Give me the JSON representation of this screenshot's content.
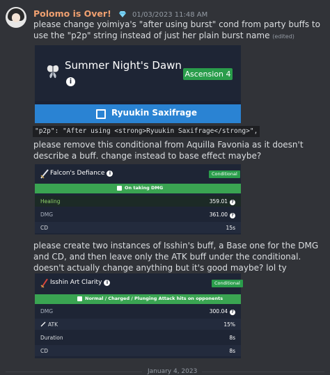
{
  "message": {
    "username": "Polomo is Over!",
    "timestamp": "01/03/2023 11:48 AM",
    "colors": {
      "username": "#f0a070",
      "background": "#313338",
      "text": "#dbdee1"
    },
    "text1": "please change yoimiya's \"after using burst\" cond from party buffs to use the \"p2p\" string instead of just her plain burst name",
    "edited": "(edited)",
    "code": "\"p2p\": \"After using <strong>Ryuukin Saxifrage</strong>\",",
    "text2": "please remove this conditional from Aquilla Favonia as it doesn't describe a buff. change instead to base effect maybe?",
    "text3": "please create two instances of Isshin's buff, a Base one for the DMG and CD, and then leave only the ATK buff under the conditional. doesn't actually change anything but it's good maybe? lol ty"
  },
  "embed1": {
    "title": "Summer Night's Dawn",
    "badge": "Ascension 4",
    "checkbox_label": "Ryuukin Saxifrage",
    "info_glyph": "i",
    "icon": "butterfly-icon"
  },
  "embed2": {
    "title": "Falcon's Defiance",
    "info_glyph": "i",
    "cond_badge": "Conditional",
    "bar_label": "On taking DMG",
    "rows": [
      {
        "label": "Healing",
        "value": "359.01",
        "help": "?"
      },
      {
        "label": "DMG",
        "value": "361.00",
        "help": "?"
      },
      {
        "label": "CD",
        "value": "15s"
      }
    ],
    "icon": "sword-icon"
  },
  "embed3": {
    "title": "Isshin Art Clarity",
    "info_glyph": "i",
    "cond_badge": "Conditional",
    "bar_label": "Normal / Charged / Plunging Attack hits on opponents",
    "rows": [
      {
        "label": "DMG",
        "value": "300.04",
        "help": "?"
      },
      {
        "label": "ATK",
        "value": "15%"
      },
      {
        "label": "Duration",
        "value": "8s"
      },
      {
        "label": "CD",
        "value": "8s"
      }
    ],
    "icon": "blade-icon"
  },
  "date_divider": "January 4, 2023"
}
